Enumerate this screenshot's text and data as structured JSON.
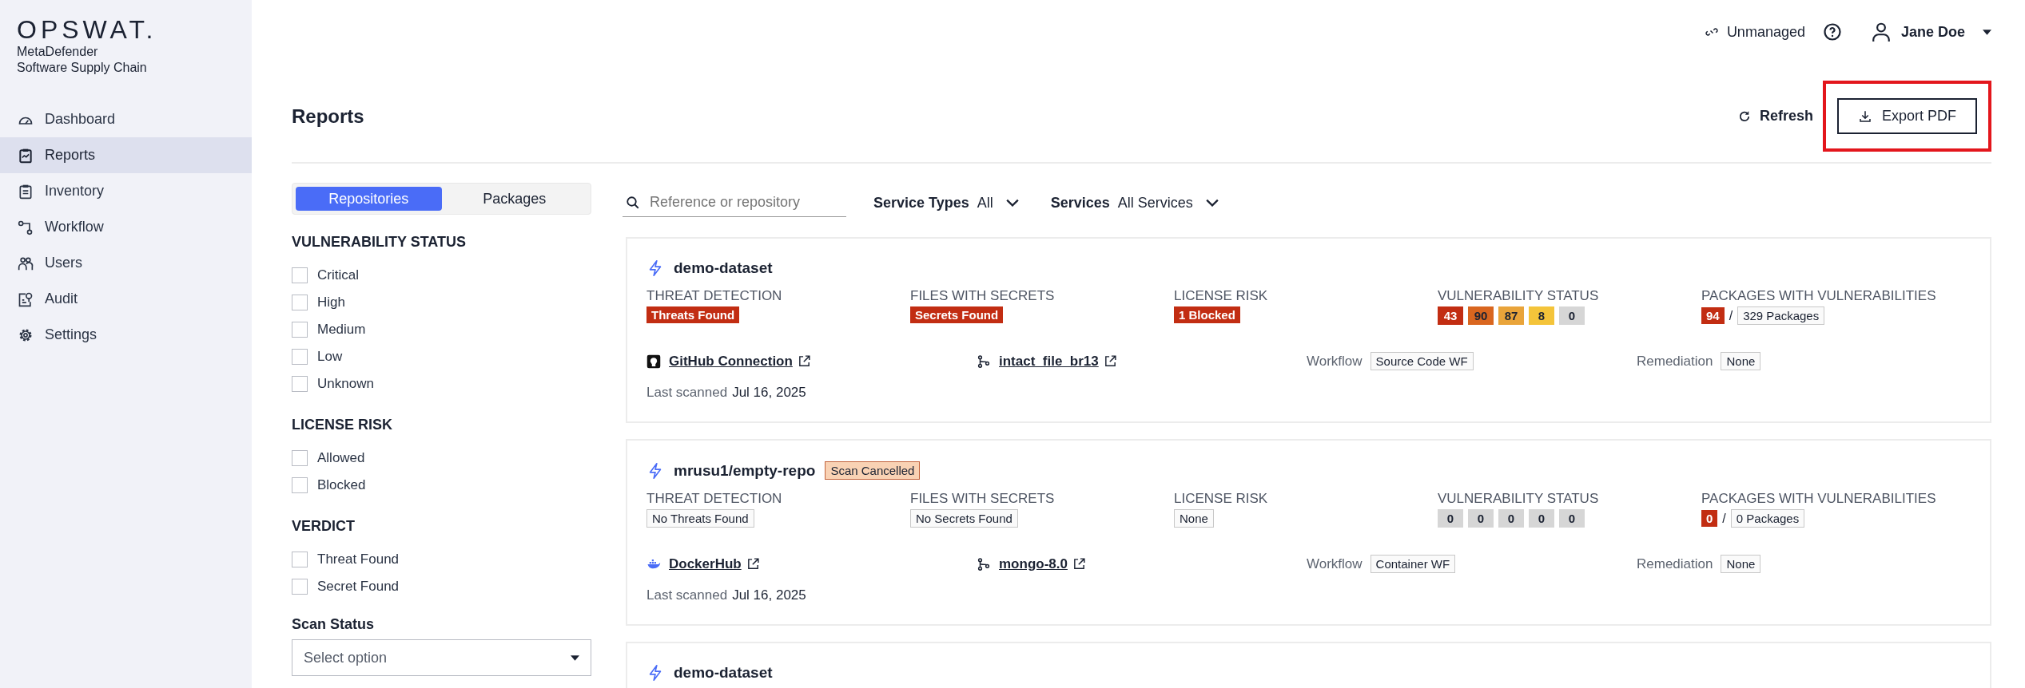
{
  "brand": {
    "logo": "OPSWAT.",
    "product": "MetaDefender",
    "subtitle": "Software Supply Chain"
  },
  "sidebar": {
    "items": [
      {
        "label": "Dashboard",
        "kind": "gauge",
        "selected": false
      },
      {
        "label": "Reports",
        "kind": "report",
        "selected": true
      },
      {
        "label": "Inventory",
        "kind": "clipboard",
        "selected": false
      },
      {
        "label": "Workflow",
        "kind": "workflow",
        "selected": false
      },
      {
        "label": "Users",
        "kind": "users",
        "selected": false
      },
      {
        "label": "Audit",
        "kind": "audit",
        "selected": false
      },
      {
        "label": "Settings",
        "kind": "gear",
        "selected": false
      }
    ]
  },
  "topbar": {
    "unmanaged": "Unmanaged",
    "user": "Jane Doe"
  },
  "page": {
    "title": "Reports",
    "refresh": "Refresh",
    "export": {
      "label": "Export PDF",
      "highlighted": true
    }
  },
  "tabs": [
    {
      "label": "Repositories",
      "selected": true
    },
    {
      "label": "Packages",
      "selected": false
    }
  ],
  "filter_groups": [
    {
      "title": "VULNERABILITY STATUS",
      "options": [
        {
          "label": "Critical",
          "checked": false
        },
        {
          "label": "High",
          "checked": false
        },
        {
          "label": "Medium",
          "checked": false
        },
        {
          "label": "Low",
          "checked": false
        },
        {
          "label": "Unknown",
          "checked": false
        }
      ]
    },
    {
      "title": "LICENSE RISK",
      "options": [
        {
          "label": "Allowed",
          "checked": false
        },
        {
          "label": "Blocked",
          "checked": false
        }
      ]
    },
    {
      "title": "VERDICT",
      "options": [
        {
          "label": "Threat Found",
          "checked": false
        },
        {
          "label": "Secret Found",
          "checked": false
        }
      ]
    }
  ],
  "scan_status": {
    "label": "Scan Status",
    "placeholder": "Select option"
  },
  "toolbar": {
    "search_placeholder": "Reference or repository",
    "service_types": {
      "label": "Service Types",
      "value": "All"
    },
    "services": {
      "label": "Services",
      "value": "All Services"
    }
  },
  "cards": [
    {
      "title": "demo-dataset",
      "fields": [
        {
          "label": "THREAT DETECTION",
          "value": "Threats Found",
          "flagged": true
        },
        {
          "label": "FILES WITH SECRETS",
          "value": "Secrets Found",
          "flagged": true
        },
        {
          "label": "LICENSE RISK",
          "value": "1 Blocked",
          "flagged": true
        }
      ],
      "vulnerability": {
        "label": "VULNERABILITY STATUS",
        "counts": [
          {
            "value": "43",
            "color": "#c22d12"
          },
          {
            "value": "90",
            "color": "#d9661f"
          },
          {
            "value": "87",
            "color": "#e9a43a"
          },
          {
            "value": "8",
            "color": "#f4c43a"
          },
          {
            "value": "0",
            "color": "#d6d6d6"
          }
        ]
      },
      "packages": {
        "label": "PACKAGES WITH VULNERABILITIES",
        "vulnerable": "94",
        "separator": "/",
        "total": "329 Packages"
      },
      "source": {
        "kind": "github",
        "name": "GitHub Connection"
      },
      "branch": "intact_file_br13",
      "workflow_label": "Workflow",
      "workflow": "Source Code WF",
      "remediation_label": "Remediation",
      "remediation": "None",
      "last_scanned_label": "Last scanned",
      "last_scanned": "Jul 16, 2025"
    },
    {
      "title": "mrusu1/empty-repo",
      "status_tag": "Scan Cancelled",
      "fields": [
        {
          "label": "THREAT DETECTION",
          "value": "No Threats Found",
          "flagged": false
        },
        {
          "label": "FILES WITH SECRETS",
          "value": "No Secrets Found",
          "flagged": false
        },
        {
          "label": "LICENSE RISK",
          "value": "None",
          "flagged": false
        }
      ],
      "vulnerability": {
        "label": "VULNERABILITY STATUS",
        "counts": [
          {
            "value": "0",
            "color": "#d6d6d6"
          },
          {
            "value": "0",
            "color": "#d6d6d6"
          },
          {
            "value": "0",
            "color": "#d6d6d6"
          },
          {
            "value": "0",
            "color": "#d6d6d6"
          },
          {
            "value": "0",
            "color": "#d6d6d6"
          }
        ]
      },
      "packages": {
        "label": "PACKAGES WITH VULNERABILITIES",
        "vulnerable": "0",
        "separator": "/",
        "total": "0 Packages"
      },
      "source": {
        "kind": "docker",
        "name": "DockerHub"
      },
      "branch": "mongo-8.0",
      "workflow_label": "Workflow",
      "workflow": "Container WF",
      "remediation_label": "Remediation",
      "remediation": "None",
      "last_scanned_label": "Last scanned",
      "last_scanned": "Jul 16, 2025"
    },
    {
      "title": "demo-dataset"
    }
  ]
}
